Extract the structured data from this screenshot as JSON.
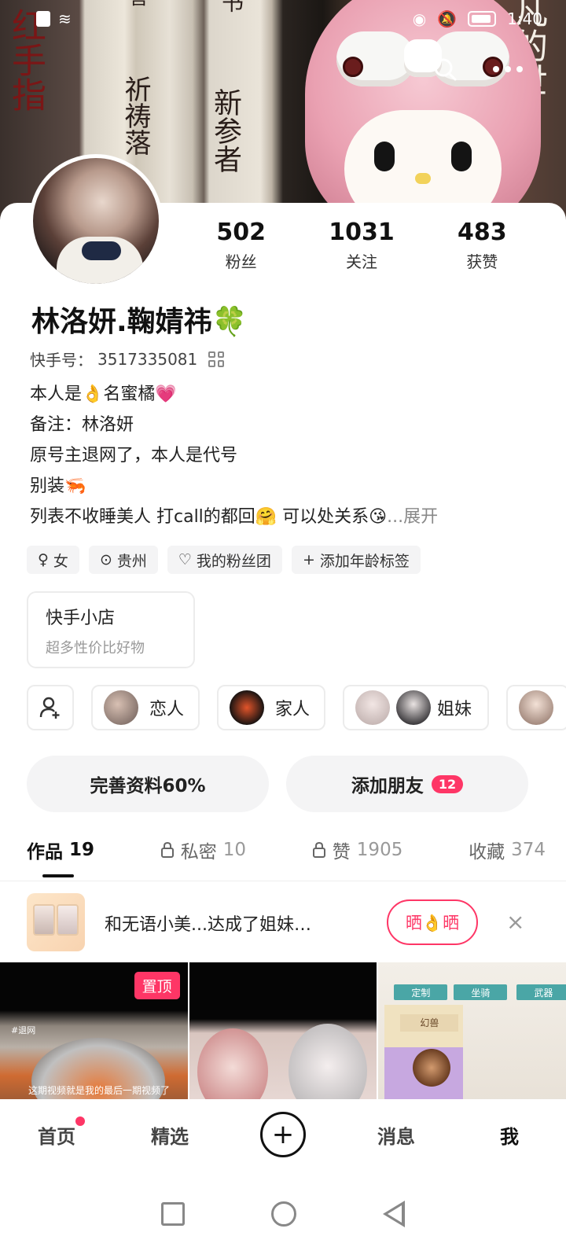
{
  "status": {
    "time": "1:40"
  },
  "cover": {
    "spine_texts": [
      "红手指",
      "祈祷落",
      "新参者",
      "书",
      "善",
      "凡的世"
    ]
  },
  "profile": {
    "stats": [
      {
        "value": "502",
        "label": "粉丝"
      },
      {
        "value": "1031",
        "label": "关注"
      },
      {
        "value": "483",
        "label": "获赞"
      }
    ],
    "name": "林洛妍.鞠婧祎🍀",
    "id_label": "快手号：",
    "id_value": "3517335081",
    "bio": [
      "本人是👌名蜜橘💗",
      "备注：林洛妍",
      "原号主退网了，本人是代号",
      "别装🦐",
      "列表不收睡美人 打call的都回🤗 可以处关系😘"
    ],
    "bio_more": "...展开",
    "tags": [
      {
        "icon": "♀",
        "label": "女"
      },
      {
        "icon": "⊙",
        "label": "贵州"
      },
      {
        "icon": "♡",
        "label": "我的粉丝团"
      },
      {
        "icon": "+",
        "label": "添加年龄标签"
      }
    ],
    "shop": {
      "title": "快手小店",
      "subtitle": "超多性价比好物"
    },
    "relations": [
      {
        "label": "恋人"
      },
      {
        "label": "家人"
      },
      {
        "label": "姐妹"
      }
    ],
    "buttons": {
      "complete": "完善资料60%",
      "add_friend": "添加朋友",
      "add_friend_badge": "12"
    }
  },
  "tabs": [
    {
      "label": "作品",
      "count": "19",
      "locked": false,
      "active": true
    },
    {
      "label": "私密",
      "count": "10",
      "locked": true,
      "active": false
    },
    {
      "label": "赞",
      "count": "1905",
      "locked": true,
      "active": false
    },
    {
      "label": "收藏",
      "count": "374",
      "locked": false,
      "active": false
    }
  ],
  "banner": {
    "text": "和无语小美...达成了姐妹…",
    "button": "晒👌晒",
    "close": "×"
  },
  "grid": {
    "pin_label": "置顶",
    "cell1_tag": "#退网",
    "cell1_caption": "这期视频就是我的最后一期视频了",
    "game_buttons": [
      "定制",
      "坐骑",
      "武器"
    ],
    "game_label": "幻兽"
  },
  "bottom_nav": [
    {
      "label": "首页"
    },
    {
      "label": "精选"
    },
    {
      "label": "+"
    },
    {
      "label": "消息"
    },
    {
      "label": "我"
    }
  ],
  "colors": {
    "accent": "#fe3666",
    "text": "#222222",
    "muted": "#999999"
  }
}
